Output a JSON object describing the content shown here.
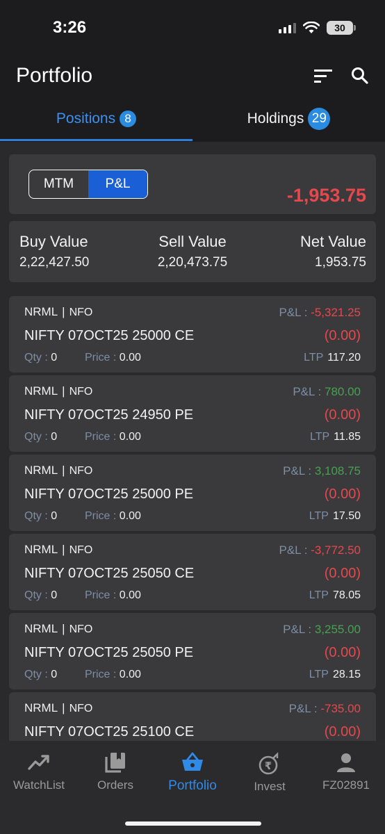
{
  "status_bar": {
    "time": "3:26",
    "battery": "30"
  },
  "header": {
    "title": "Portfolio"
  },
  "tabs": [
    {
      "label": "Positions",
      "count": "8"
    },
    {
      "label": "Holdings",
      "count": "29"
    }
  ],
  "toggle": {
    "options": [
      "MTM",
      "P&L"
    ],
    "selected": "P&L"
  },
  "total_pnl": "-1,953.75",
  "values": {
    "buy_label": "Buy Value",
    "buy": "2,22,427.50",
    "sell_label": "Sell Value",
    "sell": "2,20,473.75",
    "net_label": "Net Value",
    "net": "1,953.75"
  },
  "labels": {
    "separator": "|",
    "pnl": "P&L : ",
    "qty": "Qty : ",
    "price": "Price : ",
    "ltp": "LTP"
  },
  "positions": [
    {
      "product": "NRML",
      "exchange": "NFO",
      "name": "NIFTY 07OCT25 25000 CE",
      "pnl": "-5,321.25",
      "pnl_sign": "neg",
      "change": "(0.00)",
      "qty": "0",
      "price": "0.00",
      "ltp": "117.20"
    },
    {
      "product": "NRML",
      "exchange": "NFO",
      "name": "NIFTY 07OCT25 24950 PE",
      "pnl": "780.00",
      "pnl_sign": "pos",
      "change": "(0.00)",
      "qty": "0",
      "price": "0.00",
      "ltp": "11.85"
    },
    {
      "product": "NRML",
      "exchange": "NFO",
      "name": "NIFTY 07OCT25 25000 PE",
      "pnl": "3,108.75",
      "pnl_sign": "pos",
      "change": "(0.00)",
      "qty": "0",
      "price": "0.00",
      "ltp": "17.50"
    },
    {
      "product": "NRML",
      "exchange": "NFO",
      "name": "NIFTY 07OCT25 25050 CE",
      "pnl": "-3,772.50",
      "pnl_sign": "neg",
      "change": "(0.00)",
      "qty": "0",
      "price": "0.00",
      "ltp": "78.05"
    },
    {
      "product": "NRML",
      "exchange": "NFO",
      "name": "NIFTY 07OCT25 25050 PE",
      "pnl": "3,255.00",
      "pnl_sign": "pos",
      "change": "(0.00)",
      "qty": "0",
      "price": "0.00",
      "ltp": "28.15"
    },
    {
      "product": "NRML",
      "exchange": "NFO",
      "name": "NIFTY 07OCT25 25100 CE",
      "pnl": "-735.00",
      "pnl_sign": "neg",
      "change": "(0.00)"
    }
  ],
  "bottom_nav": [
    {
      "label": "WatchList",
      "icon": "trending-up-icon"
    },
    {
      "label": "Orders",
      "icon": "orders-icon"
    },
    {
      "label": "Portfolio",
      "icon": "basket-icon",
      "active": true
    },
    {
      "label": "Invest",
      "icon": "rupee-invest-icon"
    },
    {
      "label": "FZ02891",
      "icon": "person-icon"
    }
  ],
  "colors": {
    "accent": "#2f8ae8",
    "negative": "#e5484d",
    "positive": "#45a24f",
    "toggle_selected": "#1a5fd6"
  }
}
